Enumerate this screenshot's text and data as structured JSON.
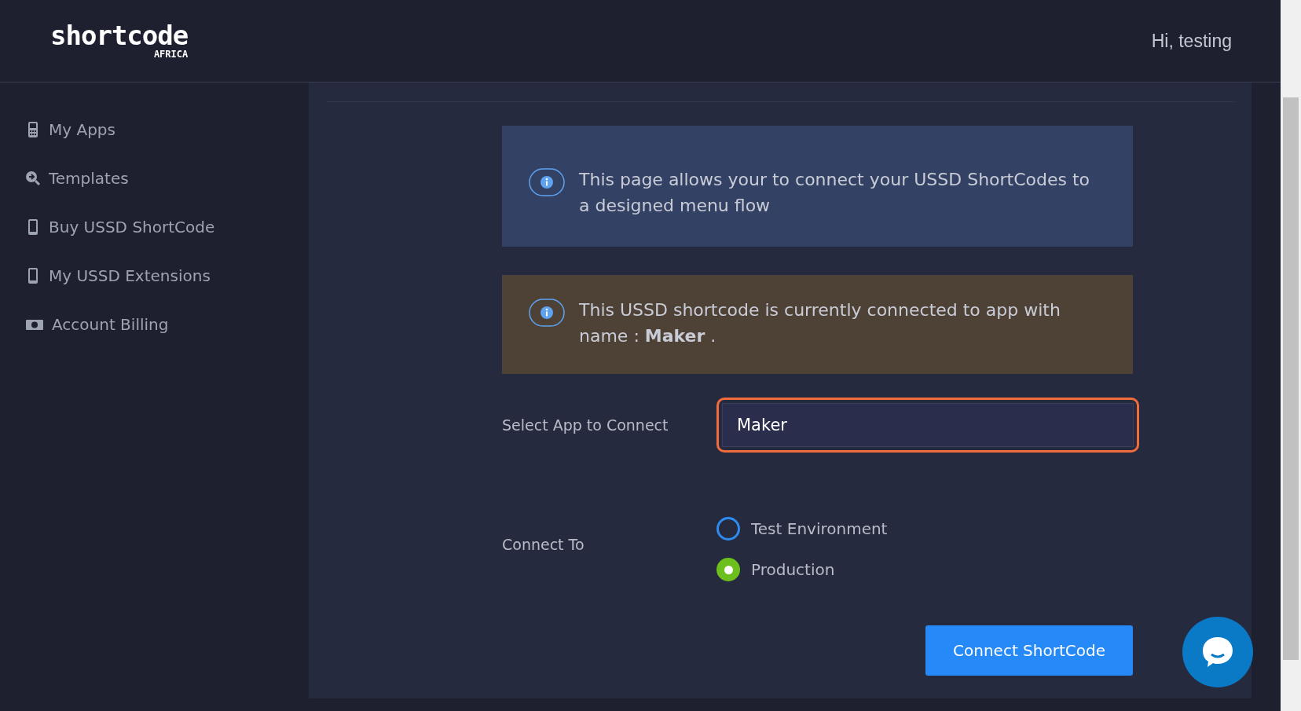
{
  "header": {
    "logo": "shortcode",
    "logo_sub": "AFRICA",
    "greeting": "Hi, testing"
  },
  "sidebar": {
    "items": [
      {
        "label": "My Apps",
        "kind": "keypad"
      },
      {
        "label": "Templates",
        "kind": "search"
      },
      {
        "label": "Buy USSD ShortCode",
        "kind": "mobile"
      },
      {
        "label": "My USSD Extensions",
        "kind": "mobile"
      },
      {
        "label": "Account Billing",
        "kind": "money"
      }
    ]
  },
  "alerts": [
    {
      "kind": "info",
      "text": "This page allows your to connect your USSD ShortCodes to a designed menu flow"
    },
    {
      "kind": "warning",
      "text": "This USSD shortcode is currently connected to app with name : **Maker** ."
    }
  ],
  "form": {
    "select_label": "Select App to Connect",
    "select_value": "Maker",
    "connect_label": "Connect To",
    "options": [
      {
        "label": "Test Environment",
        "selected": false
      },
      {
        "label": "Production",
        "selected": true
      }
    ],
    "submit": "Connect ShortCode"
  }
}
